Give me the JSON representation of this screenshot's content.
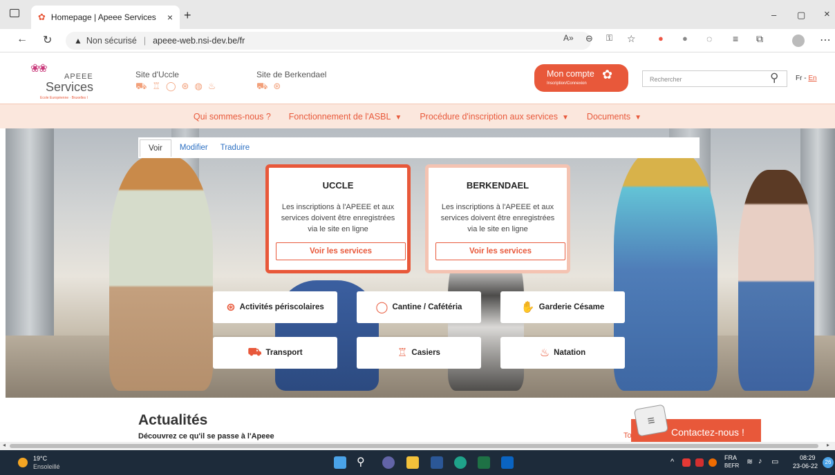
{
  "browser": {
    "tab_title": "Homepage | Apeee Services",
    "tab_close": "×",
    "new_tab": "+",
    "security": "Non sécurisé",
    "separator": "|",
    "url": "apeee-web.nsi-dev.be/fr",
    "window_controls": [
      "–",
      "▢",
      "×"
    ]
  },
  "site": {
    "logo_top": "APEEE",
    "logo_bottom": "Services",
    "logo_tagline": "Ecole Européenne · Bruxelles I",
    "site_uccle": "Site d'Uccle",
    "site_berkendael": "Site de Berkendael",
    "account_label": "Mon compte",
    "account_sub": "Inscription/Connexion",
    "search_placeholder": "Rechercher",
    "lang_fr": "Fr",
    "lang_sep": " - ",
    "lang_en": "En",
    "menu": [
      {
        "label": "Qui sommes-nous ?",
        "arrow": ""
      },
      {
        "label": "Fonctionnement de l'ASBL",
        "arrow": "▼"
      },
      {
        "label": "Procédure d'inscription aux services",
        "arrow": "▼"
      },
      {
        "label": "Documents",
        "arrow": "▼"
      }
    ],
    "edit_tabs": [
      "Voir",
      "Modifier",
      "Traduire"
    ],
    "cards": [
      {
        "title": "UCCLE",
        "text": "Les inscriptions à l'APEEE et aux services doivent être enregistrées via le site en ligne",
        "button": "Voir les services"
      },
      {
        "title": "BERKENDAEL",
        "text": "Les inscriptions à l'APEEE et aux services doivent être enregistrées via le site en ligne",
        "button": "Voir les services"
      }
    ],
    "services": [
      "Activités périscolaires",
      "Cantine / Cafétéria",
      "Garderie Césame",
      "Transport",
      "Casiers",
      "Natation"
    ],
    "news_title": "Actualités",
    "news_sub": "Découvrez ce qu'il se passe à l'Apeee",
    "news_more": "To",
    "contact": "Contactez-nous !",
    "colors": {
      "accent": "#e8583a",
      "menu_bg": "#fbe7dd"
    }
  },
  "taskbar": {
    "temp": "19°C",
    "weather": "Ensoleillé",
    "lang1": "FRA",
    "lang2": "BEFR",
    "time": "08:29",
    "date": "23-06-22",
    "badge": "26"
  }
}
